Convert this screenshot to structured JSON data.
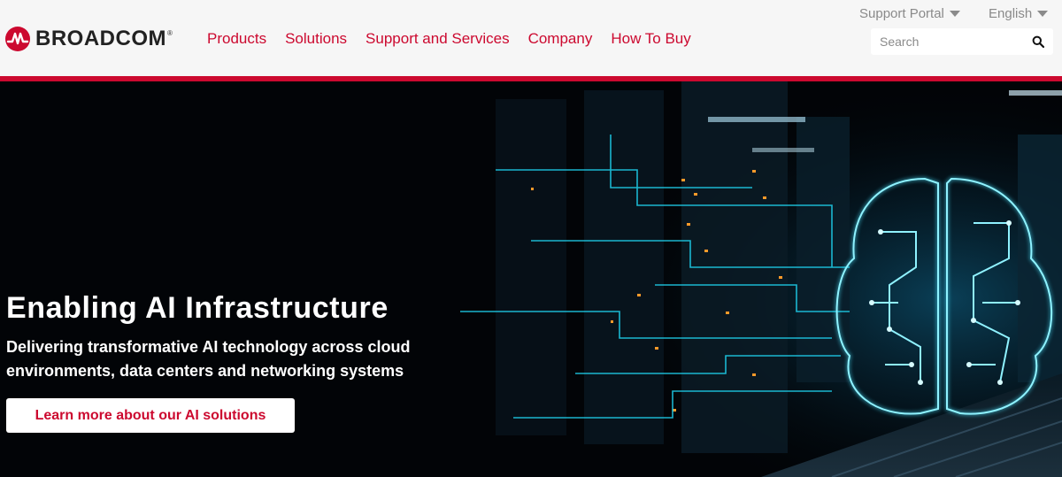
{
  "brand": {
    "name": "BROADCOM",
    "trademark": "®",
    "color": "#cc092f"
  },
  "nav": {
    "items": [
      {
        "label": "Products"
      },
      {
        "label": "Solutions"
      },
      {
        "label": "Support and Services"
      },
      {
        "label": "Company"
      },
      {
        "label": "How To Buy"
      }
    ]
  },
  "utility": {
    "support_portal": "Support Portal",
    "language": "English"
  },
  "search": {
    "placeholder": "Search",
    "icon": "search-icon"
  },
  "hero": {
    "title": "Enabling AI Infrastructure",
    "subtitle_line1": "Delivering transformative AI technology across cloud",
    "subtitle_line2": "environments, data centers and networking systems",
    "cta_label": "Learn more about our AI solutions",
    "image": "ai-brain-circuit-datacenter"
  }
}
